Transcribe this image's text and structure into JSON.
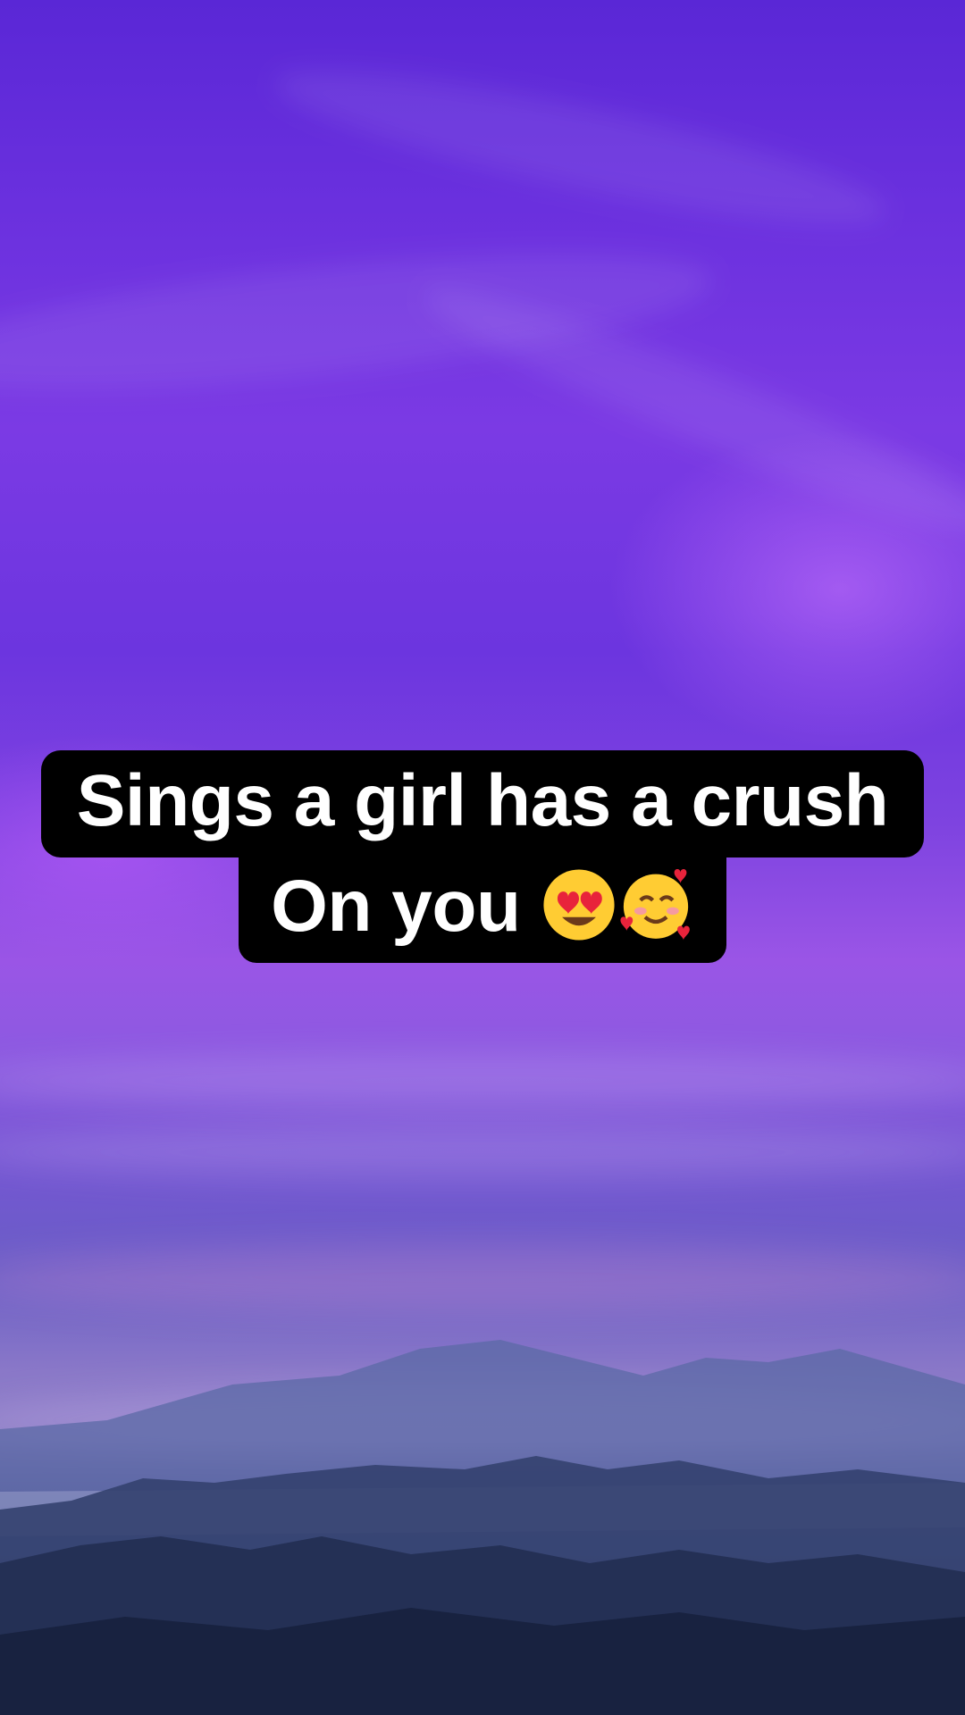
{
  "caption": {
    "line1": "Sings a girl has a crush",
    "line2": "On you",
    "emojis": [
      "smiling-face-with-heart-eyes",
      "smiling-face-with-hearts"
    ]
  },
  "colors": {
    "sky_top": "#5a27d6",
    "sky_mid": "#9a55e6",
    "horizon": "#8d7fc6",
    "mountains": "#1f2a4b",
    "caption_bg": "#000000",
    "caption_text": "#ffffff"
  }
}
